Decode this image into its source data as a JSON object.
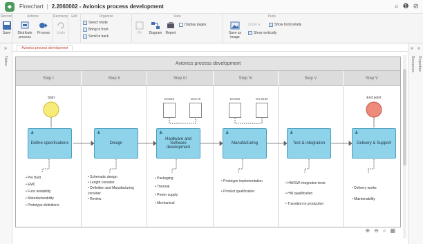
{
  "window": {
    "app_name": "Flowchart",
    "separator": "|",
    "doc_title": "2.2060002 - Avionics process development",
    "icons": [
      "notification-icon",
      "help-icon",
      "close-icon"
    ]
  },
  "ribbon": {
    "groups": [
      {
        "title": "Record"
      },
      {
        "title": "Actions"
      },
      {
        "title": "Recovery"
      },
      {
        "title": "Edit"
      },
      {
        "title": "Organize"
      },
      {
        "title": "View"
      },
      {
        "title": "Tools"
      }
    ],
    "buttons": {
      "save": "Save",
      "distribute": "Distribute process",
      "process": "Process",
      "undo": "Undo",
      "fit": "Fit",
      "diagram": "Diagram",
      "report": "Report",
      "save_image": "Save as image"
    },
    "small": {
      "select_mode": "Select mode",
      "bring_front": "Bring to front",
      "send_back": "Send to back",
      "display_pages": "Display pages",
      "zoom": "Zoom",
      "show_horizontally": "Show horizontally",
      "show_vertically": "Show vertically"
    }
  },
  "left_panel": {
    "label": "Tables"
  },
  "right_panel": {
    "label_top": "Properties",
    "label_side": "Resources"
  },
  "tabs": [
    {
      "label": "Avionics process development"
    }
  ],
  "diagram": {
    "pool_title": "Avionics process development",
    "lanes": [
      "Step I",
      "Step II",
      "Step III",
      "Step IV",
      "Step V",
      "Step V"
    ],
    "start_label": "Start",
    "end_label": "End point",
    "tasks": [
      "Define specifications",
      "Design",
      "Hardware and Software development",
      "Manufacturing",
      "Test & integration",
      "Delivery & Support"
    ],
    "docs": [
      {
        "label": "DO254"
      },
      {
        "label": "DO178"
      },
      {
        "label": "DO160"
      },
      {
        "label": "EN 9100"
      }
    ],
    "lists": [
      [
        "Pre Built",
        "EMC",
        "Func testability",
        "Manufacturability",
        "Prototype definitions"
      ],
      [
        "Schematic design",
        "Length consider",
        "Definition and Manufacturing consider",
        "Review"
      ],
      [
        "Packaging",
        "Thermal",
        "Power supply",
        "Mechanical"
      ],
      [
        "Prototype implementation",
        "Product qualification"
      ],
      [
        "HW/SW integration tests",
        "HW qualification",
        "Transition to production"
      ],
      [
        "Delivery works",
        "Maintenability"
      ]
    ]
  },
  "zoom_icons": [
    "zoom-in-icon",
    "zoom-out-icon",
    "zoom-fit-icon",
    "grid-icon"
  ]
}
